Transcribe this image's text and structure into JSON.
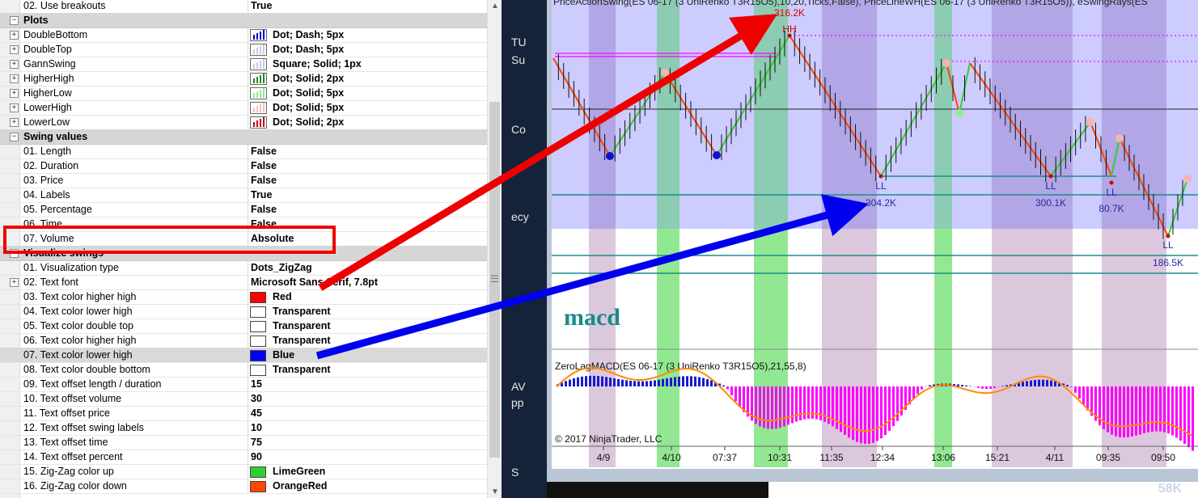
{
  "property_grid": {
    "rows": [
      {
        "kind": "prop",
        "name": "02. Use breakouts",
        "value": "True"
      },
      {
        "kind": "cat",
        "name": "Plots"
      },
      {
        "kind": "plot",
        "name": "DoubleBottom",
        "value": "Dot; Dash; 5px",
        "color": "#0000cc"
      },
      {
        "kind": "plot",
        "name": "DoubleTop",
        "value": "Dot; Dash; 5px",
        "color": "#c8c8e8"
      },
      {
        "kind": "plot",
        "name": "GannSwing",
        "value": "Square; Solid; 1px",
        "color": "#c8c8e8"
      },
      {
        "kind": "plot",
        "name": "HigherHigh",
        "value": "Dot; Solid; 2px",
        "color": "#228b22"
      },
      {
        "kind": "plot",
        "name": "HigherLow",
        "value": "Dot; Solid; 5px",
        "color": "#90ee90"
      },
      {
        "kind": "plot",
        "name": "LowerHigh",
        "value": "Dot; Solid; 5px",
        "color": "#f4c0c0"
      },
      {
        "kind": "plot",
        "name": "LowerLow",
        "value": "Dot; Solid; 2px",
        "color": "#cc0000"
      },
      {
        "kind": "cat",
        "name": "Swing values"
      },
      {
        "kind": "prop",
        "name": "01. Length",
        "value": "False"
      },
      {
        "kind": "prop",
        "name": "02. Duration",
        "value": "False"
      },
      {
        "kind": "prop",
        "name": "03. Price",
        "value": "False"
      },
      {
        "kind": "prop",
        "name": "04. Labels",
        "value": "True"
      },
      {
        "kind": "prop",
        "name": "05. Percentage",
        "value": "False"
      },
      {
        "kind": "prop",
        "name": "06. Time",
        "value": "False"
      },
      {
        "kind": "prop",
        "name": "07. Volume",
        "value": "Absolute"
      },
      {
        "kind": "cat",
        "name": "Visualize swings"
      },
      {
        "kind": "prop",
        "name": "01. Visualization type",
        "value": "Dots_ZigZag"
      },
      {
        "kind": "propexp",
        "name": "02. Text font",
        "value": "Microsoft Sans Serif, 7.8pt"
      },
      {
        "kind": "color",
        "name": "03. Text color higher high",
        "value": "Red",
        "color": "#ff0000"
      },
      {
        "kind": "color",
        "name": "04. Text color lower high",
        "value": "Transparent",
        "color": "#ffffff"
      },
      {
        "kind": "color",
        "name": "05. Text color double top",
        "value": "Transparent",
        "color": "#ffffff"
      },
      {
        "kind": "color",
        "name": "06. Text color higher high",
        "value": "Transparent",
        "color": "#ffffff"
      },
      {
        "kind": "color",
        "name": "07. Text color lower high",
        "value": "Blue",
        "color": "#0000ff",
        "selected": true
      },
      {
        "kind": "color",
        "name": "08. Text color double bottom",
        "value": "Transparent",
        "color": "#ffffff"
      },
      {
        "kind": "prop",
        "name": "09. Text offset length / duration",
        "value": "15"
      },
      {
        "kind": "prop",
        "name": "10. Text offset volume",
        "value": "30"
      },
      {
        "kind": "prop",
        "name": "11. Text offset price",
        "value": "45"
      },
      {
        "kind": "prop",
        "name": "12. Text offset swing labels",
        "value": "10"
      },
      {
        "kind": "prop",
        "name": "13. Text offset time",
        "value": "75"
      },
      {
        "kind": "prop",
        "name": "14. Text offset percent",
        "value": "90"
      },
      {
        "kind": "color",
        "name": "15. Zig-Zag color up",
        "value": "LimeGreen",
        "color": "#32cd32"
      },
      {
        "kind": "color",
        "name": "16. Zig-Zag color down",
        "value": "OrangeRed",
        "color": "#ff4500"
      }
    ]
  },
  "background_window": {
    "texts": [
      "TU",
      "Su",
      "Co",
      "ecy",
      "AV",
      "pp",
      "S"
    ]
  },
  "chart": {
    "header": "PriceActionSwing(ES 06-17 (3 UniRenko T3R15O5),10,20,Ticks,False), PriceLineWH(ES 06-17 (3 UniRenko T3R15O5)), eSwingRays(ES",
    "swing_labels": [
      {
        "text": "HH",
        "color": "#cc0000"
      },
      {
        "text": "LL",
        "color": "#2a2aa0"
      },
      {
        "text": "LL",
        "color": "#2a2aa0"
      },
      {
        "text": "LL",
        "color": "#2a2aa0"
      },
      {
        "text": "LL",
        "color": "#2a2aa0"
      }
    ],
    "volume_labels": [
      {
        "text": "316.2K",
        "color": "#dd0000"
      },
      {
        "text": "304.2K",
        "color": "#2a2aa0"
      },
      {
        "text": "300.1K",
        "color": "#2a2aa0"
      },
      {
        "text": "80.7K",
        "color": "#2a2aa0"
      },
      {
        "text": "186.5K",
        "color": "#2a2aa0"
      }
    ],
    "macd_logo": "macd",
    "macd_header": "ZeroLagMACD(ES 06-17 (3 UniRenko T3R15O5),21,55,8)",
    "copyright": "© 2017 NinjaTrader, LLC",
    "time_labels": [
      "4/9",
      "4/10",
      "07:37",
      "10:31",
      "11:35",
      "12:34",
      "13:06",
      "15:21",
      "4/11",
      "09:35",
      "09:50"
    ],
    "colors": {
      "up": "#32cd32",
      "down": "#ff4500",
      "macd_pos": "#1a1ad0",
      "macd_neg": "#ff00ff",
      "signal": "#ff8c00"
    }
  },
  "taskbar": {
    "label": "58K"
  }
}
